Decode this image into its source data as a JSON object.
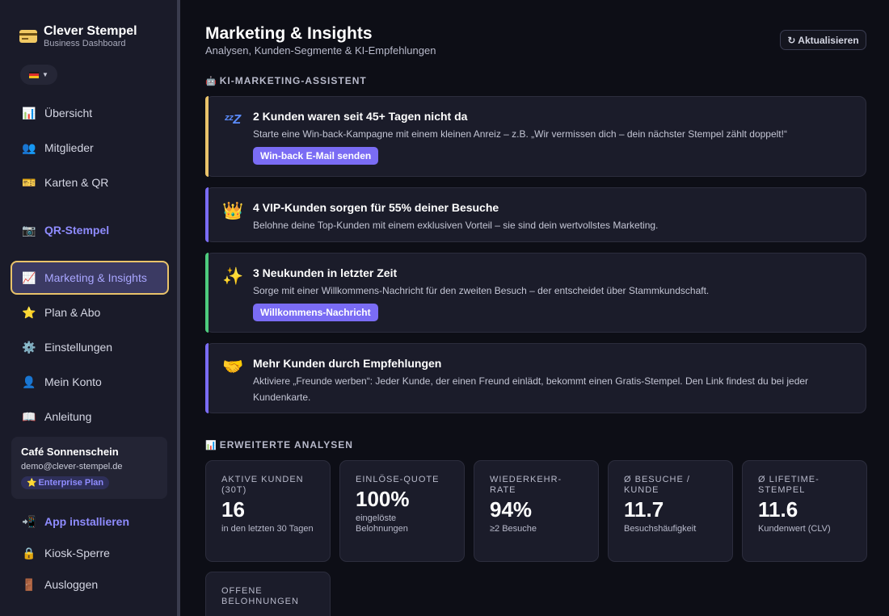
{
  "brand": {
    "title": "Clever Stempel",
    "subtitle": "Business Dashboard"
  },
  "nav": {
    "overview": "Übersicht",
    "members": "Mitglieder",
    "cards": "Karten & QR",
    "qr_stamp": "QR-Stempel",
    "marketing": "Marketing & Insights",
    "plan": "Plan & Abo",
    "settings": "Einstellungen",
    "account": "Mein Konto",
    "guide": "Anleitung",
    "install": "App installieren",
    "kiosk": "Kiosk-Sperre",
    "logout": "Ausloggen"
  },
  "account_card": {
    "name": "Café Sonnenschein",
    "email": "demo@clever-stempel.de",
    "plan": "Enterprise Plan"
  },
  "header": {
    "title": "Marketing & Insights",
    "subtitle": "Analysen, Kunden-Segmente & KI-Empfehlungen",
    "refresh": "↻ Aktualisieren"
  },
  "ai_section": {
    "title": "KI-Marketing-Assistent",
    "cards": [
      {
        "title": "2 Kunden waren seit 45+ Tagen nicht da",
        "text": "Starte eine Win-back-Kampagne mit einem kleinen Anreiz – z.B. „Wir vermissen dich – dein nächster Stempel zählt doppelt!“",
        "button": "Win-back E-Mail senden",
        "accent": "#e9c36a"
      },
      {
        "title": "4 VIP-Kunden sorgen für 55% deiner Besuche",
        "text": "Belohne deine Top-Kunden mit einem exklusiven Vorteil – sie sind dein wertvollstes Marketing.",
        "accent": "#7a6cf4"
      },
      {
        "title": "3 Neukunden in letzter Zeit",
        "text": "Sorge mit einer Willkommens-Nachricht für den zweiten Besuch – der entscheidet über Stammkundschaft.",
        "button": "Willkommens-Nachricht",
        "accent": "#4ecb7e"
      },
      {
        "title": "Mehr Kunden durch Empfehlungen",
        "text": "Aktiviere „Freunde werben“: Jeder Kunde, der einen Freund einlädt, bekommt einen Gratis-Stempel. Den Link findest du bei jeder Kundenkarte.",
        "accent": "#7a6cf4"
      }
    ]
  },
  "analytics_section": {
    "title": "Erweiterte Analysen",
    "stats": [
      {
        "label": "Aktive Kunden (30T)",
        "value": "16",
        "desc": "in den letzten 30 Tagen"
      },
      {
        "label": "Einlöse-Quote",
        "value": "100%",
        "desc": "eingelöste Belohnungen"
      },
      {
        "label": "Wiederkehr-Rate",
        "value": "94%",
        "desc": "≥2 Besuche"
      },
      {
        "label": "Ø Besuche / Kunde",
        "value": "11.7",
        "desc": "Besuchshäufigkeit"
      },
      {
        "label": "Ø Lifetime-Stempel",
        "value": "11.6",
        "desc": "Kundenwert (CLV)"
      },
      {
        "label": "Offene Belohnungen"
      }
    ]
  },
  "icons": {
    "brand": "credit-card-icon",
    "overview": "bar-chart-icon",
    "members": "people-icon",
    "cards": "ticket-icon",
    "qr_stamp": "camera-icon",
    "marketing": "trend-chart-icon",
    "plan": "star-icon",
    "settings": "gear-icon",
    "account": "person-icon",
    "guide": "book-icon",
    "install": "mobile-phone-icon",
    "kiosk": "lock-icon",
    "logout": "door-icon",
    "ai": "robot-icon",
    "analytics": "bar-chart-icon",
    "card1": "sleeping-zzz-icon",
    "card2": "crown-icon",
    "card3": "sparkles-icon",
    "card4": "handshake-icon"
  },
  "colors": {
    "primary": "#7a6cf4",
    "active_border": "#e9c36a",
    "background": "#0d0e16",
    "sidebar": "#1a1b29"
  }
}
